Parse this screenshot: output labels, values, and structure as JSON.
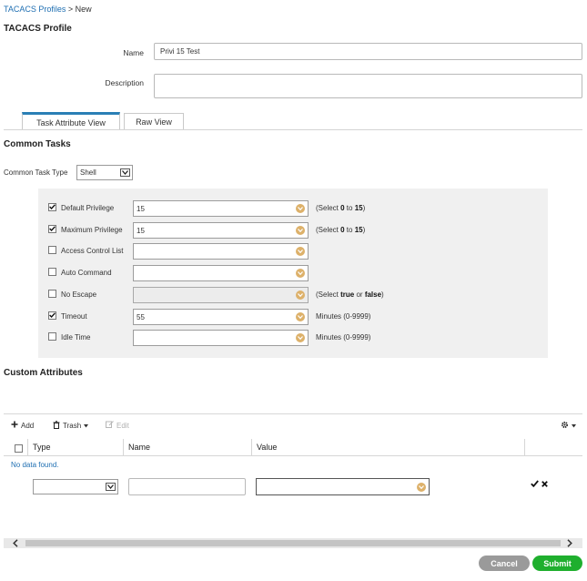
{
  "breadcrumb": {
    "parent": "TACACS Profiles",
    "separator": " > ",
    "current": "New"
  },
  "page_title": "TACACS Profile",
  "form": {
    "name_label": "Name",
    "name_value": "Privi 15 Test",
    "description_label": "Description",
    "description_value": ""
  },
  "tabs": [
    {
      "label": "Task Attribute View",
      "active": true
    },
    {
      "label": "Raw View",
      "active": false
    }
  ],
  "common_tasks": {
    "title": "Common Tasks",
    "type_label": "Common Task Type",
    "type_value": "Shell",
    "rows": [
      {
        "label": "Default Privilege",
        "checked": true,
        "value": "15",
        "disabled": false,
        "hint_pre": "(Select ",
        "hint_b1": "0",
        "hint_mid": " to ",
        "hint_b2": "15",
        "hint_post": ")"
      },
      {
        "label": "Maximum Privilege",
        "checked": true,
        "value": "15",
        "disabled": false,
        "hint_pre": "(Select ",
        "hint_b1": "0",
        "hint_mid": " to ",
        "hint_b2": "15",
        "hint_post": ")"
      },
      {
        "label": "Access Control List",
        "checked": false,
        "value": "",
        "disabled": false,
        "hint_pre": "",
        "hint_b1": "",
        "hint_mid": "",
        "hint_b2": "",
        "hint_post": ""
      },
      {
        "label": "Auto Command",
        "checked": false,
        "value": "",
        "disabled": false,
        "hint_pre": "",
        "hint_b1": "",
        "hint_mid": "",
        "hint_b2": "",
        "hint_post": ""
      },
      {
        "label": "No Escape",
        "checked": false,
        "value": "",
        "disabled": true,
        "hint_pre": "(Select ",
        "hint_b1": "true",
        "hint_mid": " or ",
        "hint_b2": "false",
        "hint_post": ")"
      },
      {
        "label": "Timeout",
        "checked": true,
        "value": "55",
        "disabled": false,
        "hint_pre": "Minutes (0-9999)",
        "hint_b1": "",
        "hint_mid": "",
        "hint_b2": "",
        "hint_post": ""
      },
      {
        "label": "Idle Time",
        "checked": false,
        "value": "",
        "disabled": false,
        "hint_pre": "Minutes (0-9999)",
        "hint_b1": "",
        "hint_mid": "",
        "hint_b2": "",
        "hint_post": ""
      }
    ]
  },
  "custom_attributes": {
    "title": "Custom Attributes",
    "toolbar": {
      "add": "Add",
      "trash": "Trash",
      "edit": "Edit"
    },
    "columns": [
      "Type",
      "Name",
      "Value"
    ],
    "empty_text": "No data found.",
    "new_row": {
      "type": "",
      "name": "",
      "value": ""
    }
  },
  "buttons": {
    "cancel": "Cancel",
    "submit": "Submit"
  },
  "colors": {
    "accent": "#2a7fb5",
    "submit": "#1faf2e",
    "cancel": "#9a9a9a",
    "dropdown_chevron": "#ddb16a",
    "panel": "#f0f0f0"
  },
  "icons": [
    "plus-icon",
    "trash-icon",
    "edit-icon",
    "gear-icon",
    "checkmark-icon",
    "close-icon",
    "chevron-down-icon",
    "chevron-left-icon",
    "chevron-right-icon"
  ]
}
